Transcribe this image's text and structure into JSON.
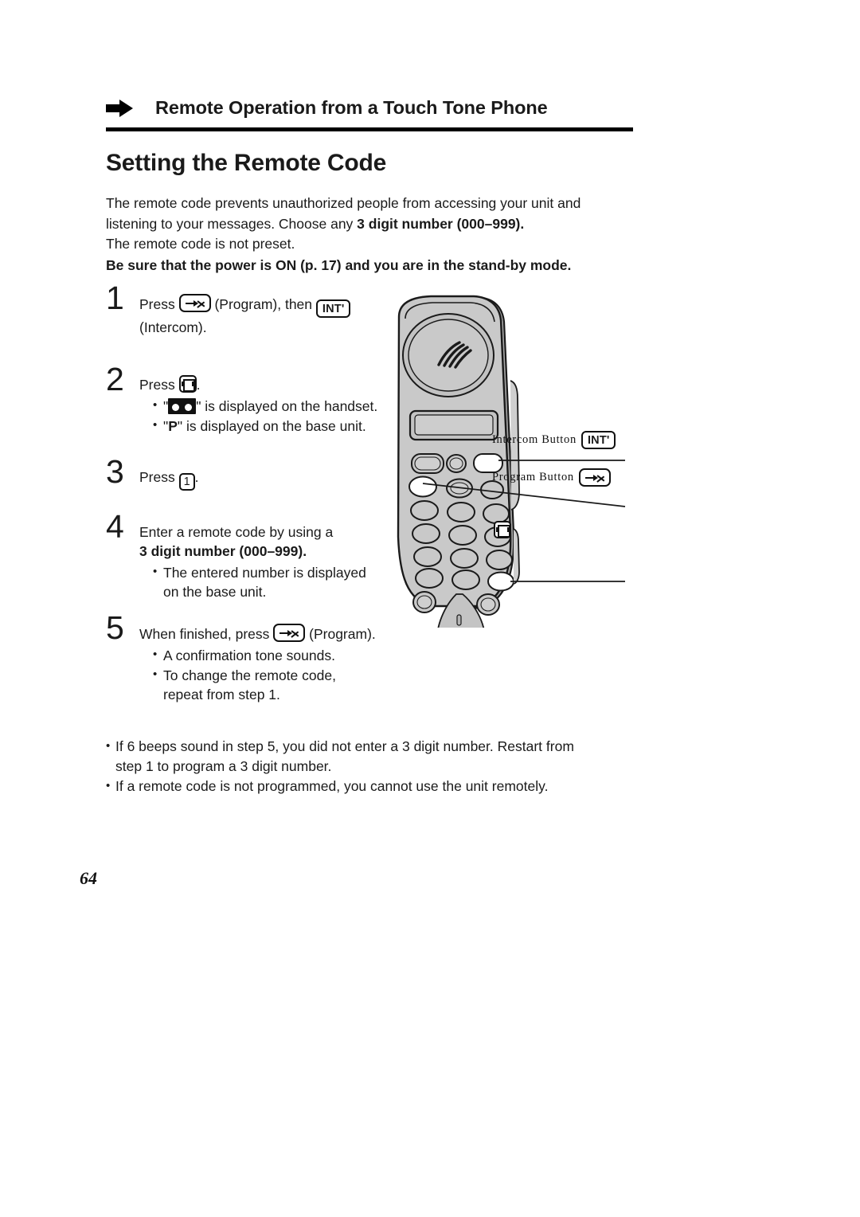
{
  "running_head": {
    "title": "Remote Operation from a Touch Tone Phone",
    "arrow_icon": "right-arrow-icon"
  },
  "section": {
    "title": "Setting the Remote Code"
  },
  "intro": {
    "line1": "The remote code prevents unauthorized people from accessing your unit and",
    "line2_pre": "listening to your messages. Choose any ",
    "line2_bold": "3 digit number (000–999).",
    "line3": "The remote code is not preset.",
    "warning": "Be sure that the power is ON (p. 17) and you are in the stand-by mode."
  },
  "steps": [
    {
      "number": "1",
      "text_pre": "Press ",
      "key1": "program-key",
      "text_mid": " (Program), then ",
      "key2_label": "INT'",
      "text_post": "(Intercom)."
    },
    {
      "number": "2",
      "text_pre": "Press ",
      "key1": "tape-key",
      "text_post": ".",
      "bullets": [
        {
          "pre": "\"",
          "glyph": "cassette-display-glyph",
          "post": "\" is displayed on the handset."
        },
        {
          "pre": "\"",
          "bold": "P",
          "post": "\" is displayed on the base unit."
        }
      ]
    },
    {
      "number": "3",
      "text_pre": "Press ",
      "key_digit": "1",
      "text_post": "."
    },
    {
      "number": "4",
      "line1": "Enter a remote code by using a",
      "line2_bold": "3 digit number (000–999).",
      "bullets": [
        {
          "line1": "The entered number is displayed",
          "line2": "on the base unit."
        }
      ]
    },
    {
      "number": "5",
      "text_pre": "When finished, press ",
      "key1": "program-key",
      "text_post": " (Program).",
      "bullets": [
        {
          "line1": "A confirmation tone sounds."
        },
        {
          "line1": "To change the remote code,",
          "line2": "repeat from step 1."
        }
      ]
    }
  ],
  "figure": {
    "alt": "cordless-handset-illustration",
    "callouts": [
      {
        "label": "Intercom Button",
        "key": "INT'",
        "key_type": "int-key"
      },
      {
        "label": "Program Button",
        "key": "",
        "key_type": "program-key"
      },
      {
        "label": "",
        "key": "",
        "key_type": "tape-key"
      }
    ]
  },
  "notes": [
    {
      "line1": "If 6 beeps sound in step 5, you did not enter a 3 digit number. Restart from",
      "line2": "step 1 to program a 3 digit number."
    },
    {
      "line1": "If a remote code is not programmed, you cannot use the unit remotely."
    }
  ],
  "page_number": "64",
  "colors": {
    "text": "#1a1a1a",
    "rule": "#000000",
    "handset_body": "#c9c9c9",
    "handset_dark": "#9a9a9a",
    "handset_light": "#e2e2e2",
    "outline": "#1a1a1a"
  }
}
